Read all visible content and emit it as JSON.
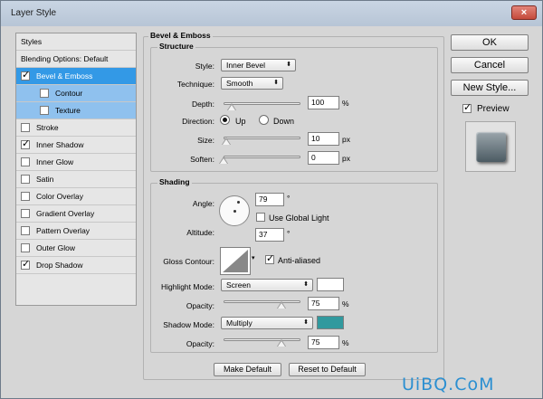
{
  "window": {
    "title": "Layer Style",
    "close_glyph": "×"
  },
  "styles_panel": {
    "header": "Styles",
    "blending": "Blending Options: Default",
    "items": [
      {
        "label": "Bevel & Emboss",
        "checked": true
      },
      {
        "label": "Contour",
        "checked": false
      },
      {
        "label": "Texture",
        "checked": false
      },
      {
        "label": "Stroke",
        "checked": false
      },
      {
        "label": "Inner Shadow",
        "checked": true
      },
      {
        "label": "Inner Glow",
        "checked": false
      },
      {
        "label": "Satin",
        "checked": false
      },
      {
        "label": "Color Overlay",
        "checked": false
      },
      {
        "label": "Gradient Overlay",
        "checked": false
      },
      {
        "label": "Pattern Overlay",
        "checked": false
      },
      {
        "label": "Outer Glow",
        "checked": false
      },
      {
        "label": "Drop Shadow",
        "checked": true
      }
    ]
  },
  "bevel": {
    "title": "Bevel & Emboss",
    "structure_title": "Structure",
    "style_label": "Style:",
    "style_value": "Inner Bevel",
    "technique_label": "Technique:",
    "technique_value": "Smooth",
    "depth_label": "Depth:",
    "depth_value": "100",
    "depth_unit": "%",
    "depth_level": 100,
    "direction_label": "Direction:",
    "dir_up": "Up",
    "dir_down": "Down",
    "size_label": "Size:",
    "size_value": "10",
    "size_unit": "px",
    "size_level": 10,
    "soften_label": "Soften:",
    "soften_value": "0",
    "soften_unit": "px",
    "soften_level": 0
  },
  "shading": {
    "title": "Shading",
    "angle_label": "Angle:",
    "angle_value": "79",
    "degree": "°",
    "global_light": "Use Global Light",
    "altitude_label": "Altitude:",
    "altitude_value": "37",
    "gloss_label": "Gloss Contour:",
    "anti_aliased": "Anti-aliased",
    "highlight_label": "Highlight Mode:",
    "highlight_value": "Screen",
    "highlight_color": "#ffffff",
    "opacity_label": "Opacity:",
    "hl_opacity": "75",
    "hl_opacity_level": 75,
    "percent": "%",
    "shadow_label": "Shadow Mode:",
    "shadow_value": "Multiply",
    "shadow_color": "#31999e",
    "sh_opacity": "75",
    "sh_opacity_level": 75
  },
  "bottom": {
    "make_default": "Make Default",
    "reset_default": "Reset to Default"
  },
  "side": {
    "ok": "OK",
    "cancel": "Cancel",
    "new_style": "New Style...",
    "preview": "Preview"
  },
  "watermark": "UiBQ.CoM"
}
